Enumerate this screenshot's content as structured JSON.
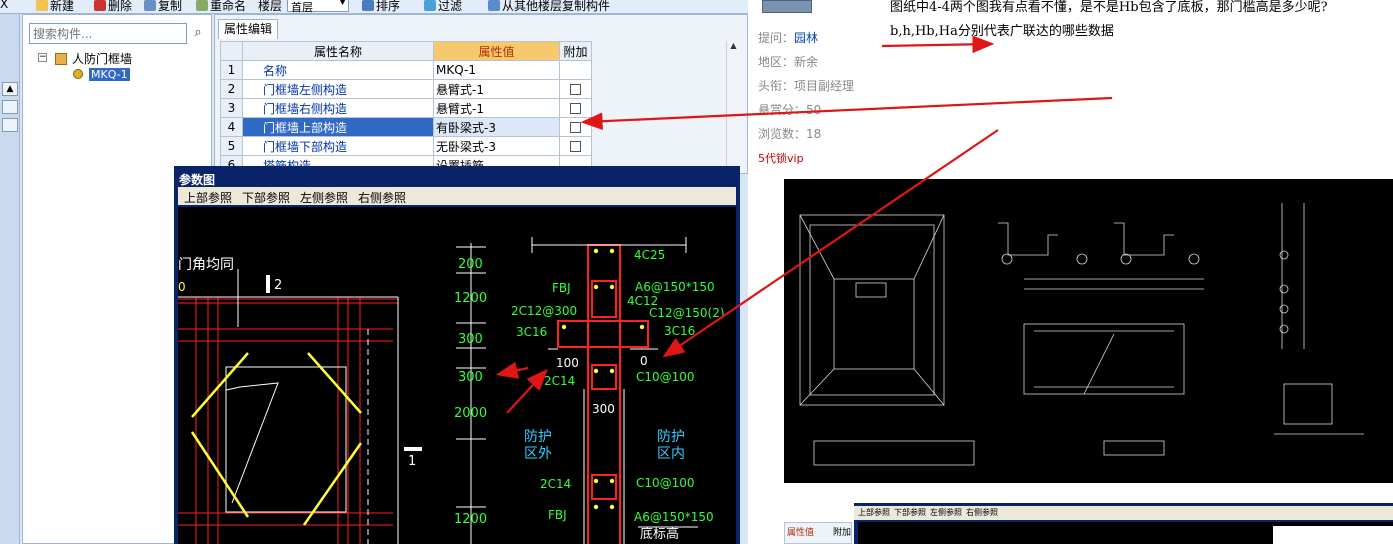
{
  "toolbar": {
    "items": [
      "新建",
      "删除",
      "复制",
      "重命名",
      "楼层",
      "排序",
      "过滤",
      "从其他楼层复制构件"
    ],
    "floor_value": "首层",
    "close_glyph": "X"
  },
  "tree": {
    "search_placeholder": "搜索构件...",
    "root_label": "人防门框墙",
    "child_label": "MKQ-1",
    "expander": "−"
  },
  "properties": {
    "tab": "属性编辑",
    "headers": [
      "属性名称",
      "属性值",
      "附加"
    ],
    "rows": [
      {
        "n": "1",
        "name": "名称",
        "value": "MKQ-1",
        "checkbox": false
      },
      {
        "n": "2",
        "name": "门框墙左侧构造",
        "value": "悬臂式-1",
        "checkbox": true
      },
      {
        "n": "3",
        "name": "门框墙右侧构造",
        "value": "悬臂式-1",
        "checkbox": true
      },
      {
        "n": "4",
        "name": "门框墙上部构造",
        "value": "有卧梁式-3",
        "checkbox": true,
        "selected": true
      },
      {
        "n": "5",
        "name": "门框墙下部构造",
        "value": "无卧梁式-3",
        "checkbox": true
      },
      {
        "n": "6",
        "name": "塔筋构造",
        "value": "设置插筋",
        "checkbox": false
      }
    ]
  },
  "ref_window": {
    "title": "参数图",
    "menu": [
      "上部参照",
      "下部参照",
      "左侧参照",
      "右侧参照"
    ]
  },
  "cad": {
    "left_text": "门角均同",
    "mark2": "2",
    "mark0": "0",
    "mark1": "1",
    "dims": [
      "200",
      "1200",
      "300",
      "300",
      "2000",
      "1200"
    ],
    "labels": {
      "c4c25": "4C25",
      "fbj": "FBJ",
      "a6_top": "A6@150*150",
      "c2c12": "2C12@300",
      "c4c12": "4C12",
      "c12_2": "C12@150(2)",
      "c3c16l": "3C16",
      "c3c16r": "3C16",
      "d100": "100",
      "d0": "0",
      "c2c14": "2C14",
      "c10": "C10@100",
      "d300": "300",
      "out_zone": "防护\n区外",
      "in_zone": "防护\n区内",
      "c2c14b": "2C14",
      "c10b": "C10@100",
      "fbj2": "FBJ",
      "a6_bot": "A6@150*150",
      "bottom": "底标高"
    }
  },
  "question": {
    "line1": "图纸中4-4两个图我有点看不懂，是不是Hb包含了底板，那门槛高是多少呢?",
    "line2": "b,h,Hb,Ha分别代表广联达的哪些数据"
  },
  "info": {
    "asker_label": "提问：",
    "asker": "园林",
    "region": "地区：新余",
    "title": "头衔：项目副经理",
    "reward": "悬赏分：50",
    "views": "浏览数：18",
    "vip": "5代锁vip"
  },
  "thumb": {
    "grid_head": "属性值",
    "grid_head2": "附加",
    "menu": [
      "上部参照",
      "下部参照",
      "左侧参照",
      "右侧参照"
    ]
  },
  "colors": {
    "arrow": "#e01515",
    "cad_green": "#33ff33",
    "cad_red": "#ff2020",
    "cad_yellow": "#ffff33",
    "selection": "#316ac5"
  }
}
